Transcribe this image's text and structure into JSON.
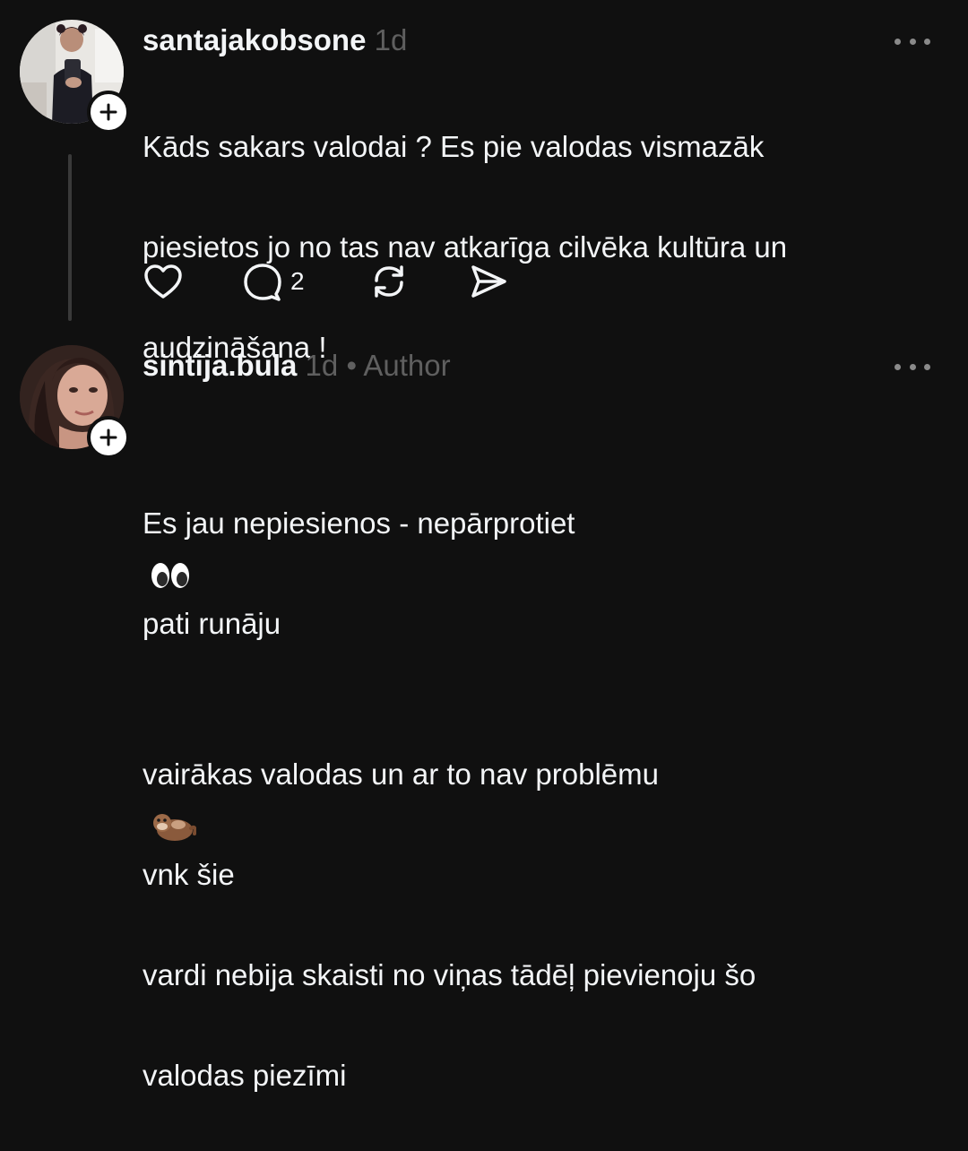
{
  "comments": [
    {
      "username": "santajakobsone",
      "time": "1d",
      "author_label": "",
      "lines": [
        "Kāds sakars valodai ? Es pie valodas vismazāk",
        "piesietos jo no tas nav atkarīga cilvēka kultūra un",
        "audzināšana !"
      ],
      "actions": {
        "like_icon": "heart-icon",
        "reply_icon": "comment-icon",
        "reply_count": "2",
        "repost_icon": "repost-icon",
        "share_icon": "send-icon"
      }
    },
    {
      "username": "sintija.bula",
      "time": "1d",
      "separator": "•",
      "author_label": "Author",
      "lines": [
        "Es jau nepiesienos - nepārprotiet",
        "pati runāju",
        "vairākas valodas un ar to nav problēmu",
        "vnk šie",
        "vardi nebija skaisti no viņas tādēļ pievienoju šo",
        "valodas piezīmi"
      ],
      "emojis": [
        "eyes-emoji",
        "otter-emoji"
      ]
    }
  ],
  "colors": {
    "background": "#101010",
    "text": "#f3f5f7",
    "muted": "#5f5f5f",
    "thread_line": "#3a3a3a"
  }
}
